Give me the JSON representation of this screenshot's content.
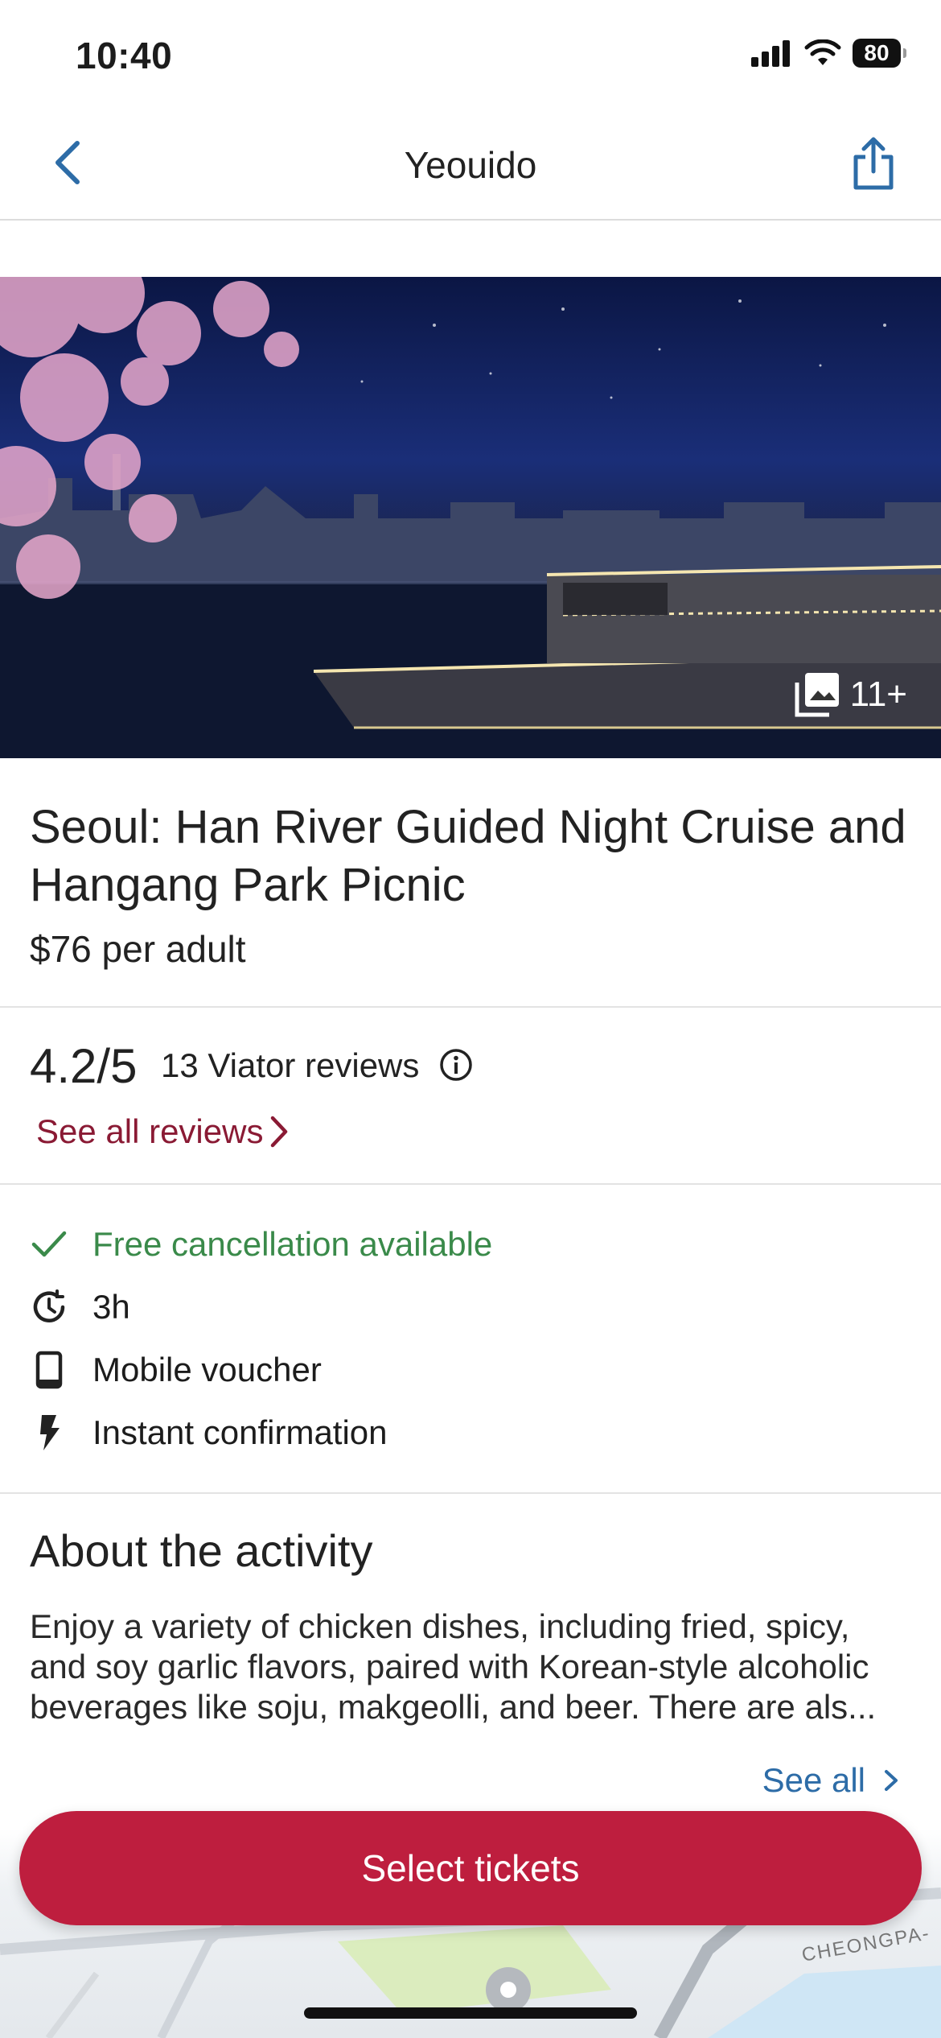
{
  "status": {
    "time": "10:40",
    "battery": "80"
  },
  "nav": {
    "title": "Yeouido"
  },
  "hero": {
    "photo_count": "11+"
  },
  "activity": {
    "title": "Seoul: Han River Guided Night Cruise and Hangang Park Picnic",
    "price": "$76",
    "price_unit": "per adult"
  },
  "reviews": {
    "rating": "4.2/5",
    "count_label": "13 Viator reviews",
    "see_all": "See all reviews"
  },
  "features": [
    {
      "icon": "check-icon",
      "label": "Free cancellation available",
      "color": "#3a8a4a"
    },
    {
      "icon": "clock-icon",
      "label": "3h"
    },
    {
      "icon": "phone-icon",
      "label": "Mobile voucher"
    },
    {
      "icon": "lightning-icon",
      "label": "Instant confirmation"
    }
  ],
  "about": {
    "heading": "About the activity",
    "text": "Enjoy a variety of chicken dishes, including fried, spicy, and soy garlic flavors, paired with Korean-style alcoholic beverages like soju, makgeolli, and beer. There are als...",
    "see_all": "See all"
  },
  "map": {
    "label": "CHEONGPA-"
  },
  "cta": {
    "label": "Select tickets"
  },
  "colors": {
    "accent": "#be1e3e",
    "link_dark": "#8a1a34",
    "link_blue": "#2d6ca7",
    "success": "#3a8a4a"
  }
}
